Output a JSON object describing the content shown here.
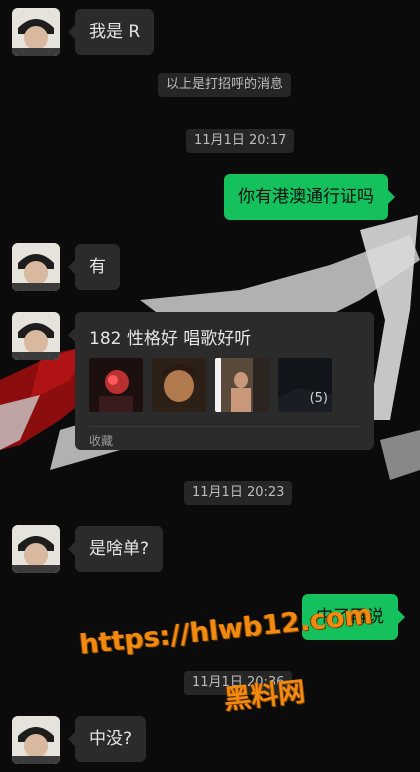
{
  "colors": {
    "background": "#0b0b0b",
    "incoming_bubble": "#2b2b2b",
    "outgoing_bubble": "#15c15d",
    "system_bubble": "#262626",
    "watermark": "#f28a12"
  },
  "messages": [
    {
      "type": "incoming",
      "text": "我是 R"
    },
    {
      "type": "system",
      "text": "以上是打招呼的消息"
    },
    {
      "type": "timestamp",
      "text": "11月1日 20:17"
    },
    {
      "type": "outgoing",
      "text": "你有港澳通行证吗"
    },
    {
      "type": "incoming",
      "text": "有"
    },
    {
      "type": "incoming_card",
      "title": "182 性格好 唱歌好听",
      "thumb_count": "(5)",
      "footer": "收藏"
    },
    {
      "type": "timestamp",
      "text": "11月1日 20:23"
    },
    {
      "type": "incoming",
      "text": "是啥单?"
    },
    {
      "type": "outgoing",
      "text": "中了再说"
    },
    {
      "type": "timestamp",
      "text": "11月1日 20:36"
    },
    {
      "type": "incoming",
      "text": "中没?"
    }
  ],
  "watermark": {
    "url": "https://hlwb12.com",
    "name": "黑料网"
  },
  "icons": [
    "avatar",
    "photo-thumbnail"
  ]
}
